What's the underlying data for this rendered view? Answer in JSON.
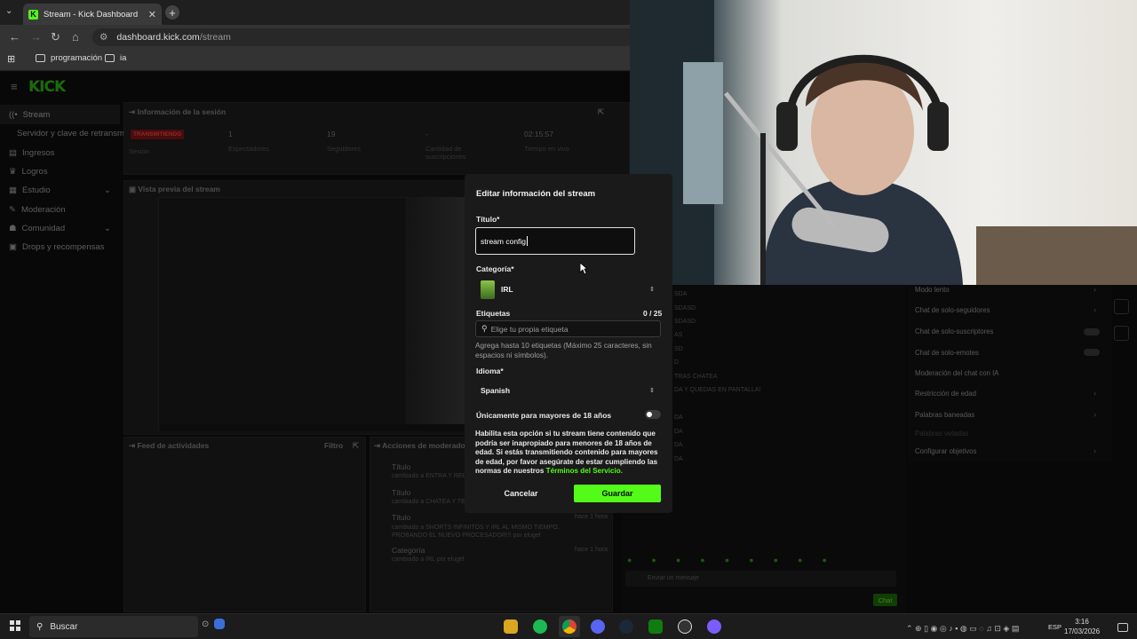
{
  "browser": {
    "tab_title": "Stream - Kick Dashboard",
    "url_domain": "dashboard.kick.com",
    "url_path": "/stream",
    "bookmarks": [
      "programación",
      "ia"
    ]
  },
  "kick": {
    "logo": "KICK",
    "sidebar": {
      "stream": "Stream",
      "stream_sub": "Servidor y clave de retransmisión",
      "items": [
        "Ingresos",
        "Logros",
        "Estudio",
        "Moderación",
        "Comunidad",
        "Drops y recompensas"
      ]
    },
    "session": {
      "title": "Información de la sesión",
      "badge": "TRANSMITIENDO",
      "badge_label": "Sesión",
      "stats": [
        {
          "value": "1",
          "label": "Espectadores"
        },
        {
          "value": "19",
          "label": "Seguidores"
        },
        {
          "value": "-",
          "label": "Cantidad de suscripciones"
        },
        {
          "value": "02:15:57",
          "label": "Tiempo en vivo"
        }
      ]
    },
    "preview_title": "Vista previa del stream",
    "feed": {
      "title": "Feed de actividades",
      "filter": "Filtro"
    },
    "mod_actions": {
      "title": "Acciones de moderador",
      "items": [
        {
          "title": "Título",
          "detail": "cambiado a ENTRA Y RECI"
        },
        {
          "title": "Título",
          "detail": "cambiado a CHATEA Y TE"
        },
        {
          "title": "Título",
          "detail": "cambiado a SHORTS INFINITOS Y IRL AL MISMO TIEMPO, PROBANDO EL NUEVO PROCESADOR!!! por elugel",
          "time": "hace 1 hora"
        },
        {
          "title": "Categoría",
          "detail": "cambiado a IRL por elugel",
          "time": "hace 1 hora"
        }
      ]
    },
    "chat_settings": [
      "Modo lento",
      "Chat de solo-seguidores",
      "Chat de solo-suscriptores",
      "Chat de solo-emotes",
      "Moderación del chat con IA",
      "Restricción de edad",
      "Palabras baneadas",
      "Palabras vetadas",
      "Configurar objetivos"
    ],
    "chat_lines": [
      "SDA",
      "SDASD",
      "SDASD",
      "AS",
      "SD",
      "D",
      "TRAS CHATEA",
      "DA Y QUEDAS EN PANTALLA!",
      "DA",
      "DA",
      "DA",
      "DA"
    ],
    "chat_input_placeholder": "Enviar un mensaje",
    "chat_button": "Chat"
  },
  "modal": {
    "title": "Editar información del stream",
    "title_label": "Título*",
    "title_value": "stream config",
    "category_label": "Categoría*",
    "category_value": "IRL",
    "tags_label": "Etiquetas",
    "tags_count": "0 / 25",
    "tags_placeholder": "Elige tu propia etiqueta",
    "tags_help": "Agrega hasta 10 etiquetas (Máximo 25 caracteres, sin espacios ni símbolos).",
    "language_label": "Idioma*",
    "language_value": "Spanish",
    "adult_label": "Únicamente para mayores de 18 años",
    "adult_desc": "Habilita esta opción si tu stream tiene contenido que podría ser inapropiado para menores de 18 años de edad. Si estás transmitiendo contenido para mayores de edad, por favor asegúrate de estar cumpliendo las normas de nuestros",
    "adult_link": "Términos del Servicio.",
    "cancel": "Cancelar",
    "save": "Guardar"
  },
  "taskbar": {
    "search": "Buscar",
    "lang": "ESP",
    "time": "3:16",
    "date": "17/03/2026"
  },
  "colors": {
    "kick_green": "#53fc18",
    "modal_bg": "#1a1a1a",
    "live_red": "#4a0c0c"
  }
}
